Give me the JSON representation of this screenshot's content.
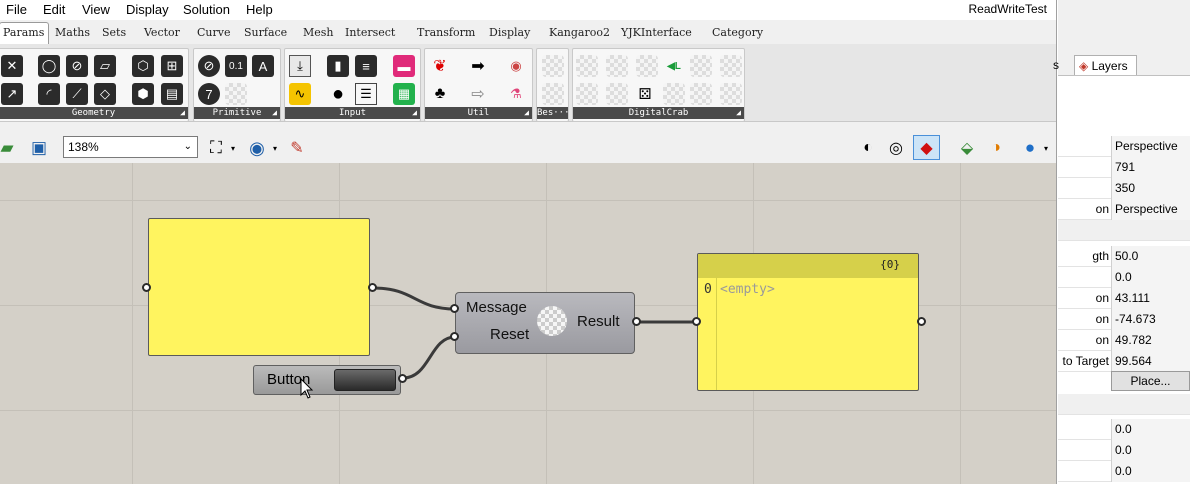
{
  "window": {
    "doc_title": "ReadWriteTest"
  },
  "menu": [
    "File",
    "Edit",
    "View",
    "Display",
    "Solution",
    "Help"
  ],
  "tabs": [
    "Params",
    "Maths",
    "Sets",
    "Vector",
    "Curve",
    "Surface",
    "Mesh",
    "Intersect",
    "Transform",
    "Display",
    "Kangaroo2",
    "YJKInterface",
    "Category"
  ],
  "ribbon_panels": [
    "Geometry",
    "Primitive",
    "Input",
    "Util",
    "Bes···",
    "DigitalCrab"
  ],
  "toolbar": {
    "zoom": "138%"
  },
  "canvas": {
    "component": {
      "inputs": [
        "Message",
        "Reset"
      ],
      "output": "Result"
    },
    "button": {
      "label": "Button"
    },
    "output_panel": {
      "path": "{0}",
      "index": "0",
      "value": "<empty>"
    }
  },
  "side_panel": {
    "tab": "Layers",
    "rows": [
      {
        "key": "",
        "value": "Perspective"
      },
      {
        "key": "",
        "value": "791"
      },
      {
        "key": "",
        "value": "350"
      },
      {
        "key": "on",
        "value": "Perspective"
      },
      {
        "key": "",
        "value": ""
      },
      {
        "key": "gth",
        "value": "50.0"
      },
      {
        "key": "",
        "value": "0.0"
      },
      {
        "key": "on",
        "value": "43.111"
      },
      {
        "key": "on",
        "value": "-74.673"
      },
      {
        "key": "on",
        "value": "49.782"
      },
      {
        "key": "to Target",
        "value": "99.564"
      }
    ],
    "place_button": "Place...",
    "bottom_rows": [
      "0.0",
      "0.0",
      "0.0"
    ],
    "prefix_s": "s"
  }
}
